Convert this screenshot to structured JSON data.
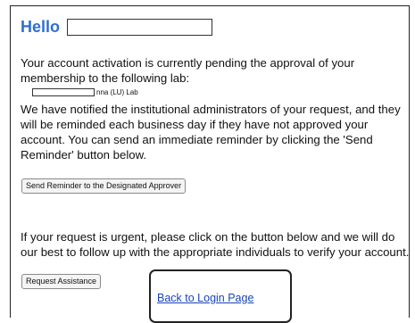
{
  "greeting": {
    "hello": "Hello"
  },
  "message": {
    "pending": "Your account activation is currently pending the approval of your membership to the following lab:",
    "lab_name_suffix": "nna (LU) Lab",
    "notified": "We have notified the institutional administrators of your request, and they will be reminded each business day if they have not approved your account. You can send an immediate reminder by clicking the 'Send Reminder' button below.",
    "urgent": "If your request is urgent, please click on the button below and we will do our best to follow up with the appropriate individuals to verify your account."
  },
  "buttons": {
    "send_reminder": "Send Reminder to the Designated Approver",
    "request_assistance": "Request Assistance"
  },
  "links": {
    "back_to_login": "Back to Login Page"
  },
  "colors": {
    "heading": "#2f6fd1",
    "link": "#1a44b8"
  }
}
